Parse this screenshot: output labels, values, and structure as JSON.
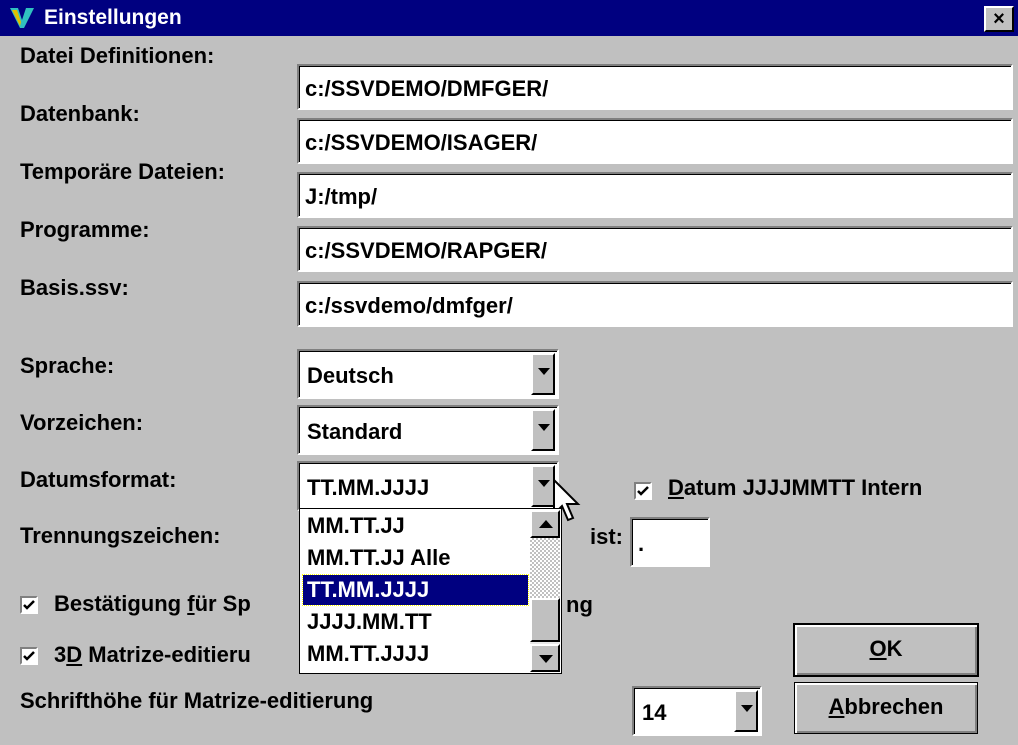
{
  "window": {
    "title": "Einstellungen",
    "close_label": "×"
  },
  "paths": [
    {
      "label": "Datei Definitionen:",
      "value": "c:/SSVDEMO/DMFGER/"
    },
    {
      "label": "Datenbank:",
      "value": "c:/SSVDEMO/ISAGER/"
    },
    {
      "label": "Temporäre Dateien:",
      "value": "J:/tmp/"
    },
    {
      "label": "Programme:",
      "value": "c:/SSVDEMO/RAPGER/"
    },
    {
      "label": "Basis.ssv:",
      "value": "c:/ssvdemo/dmfger/"
    }
  ],
  "sprache": {
    "label": "Sprache:",
    "value": "Deutsch"
  },
  "vorzeichen": {
    "label": "Vorzeichen:",
    "value": "Standard"
  },
  "datumsformat": {
    "label": "Datumsformat:",
    "value": "TT.MM.JJJJ",
    "options": [
      "MM.TT.JJ",
      "MM.TT.JJ Alle",
      "TT.MM.JJJJ",
      "JJJJ.MM.TT",
      "MM.TT.JJJJ"
    ],
    "selected_index": 2
  },
  "datum_intern": {
    "label_underlined": "D",
    "label_rest": "atum JJJJMMTT Intern",
    "checked": true
  },
  "trennungszeichen": {
    "label": "Trennungszeichen:",
    "suffix_label": "ist:",
    "value": "."
  },
  "bestaetigung": {
    "label_visible_start": "Bestätigung ",
    "label_underlined": "f",
    "label_mid": "ür Sp",
    "label_visible_end": "ng",
    "checked": true
  },
  "matrize_3d": {
    "label_start": "3",
    "label_underlined": "D",
    "label_rest": " Matrize-editieru",
    "checked": true
  },
  "schrifthoehe": {
    "label": "Schrifthöhe für Matrize-editierung",
    "value": "14"
  },
  "buttons": {
    "ok_underlined": "O",
    "ok_rest": "K",
    "cancel_underlined": "A",
    "cancel_rest": "bbrechen"
  },
  "colors": {
    "titlebar": "#000080",
    "dialog": "#c0c0c0",
    "selection": "#000080"
  }
}
